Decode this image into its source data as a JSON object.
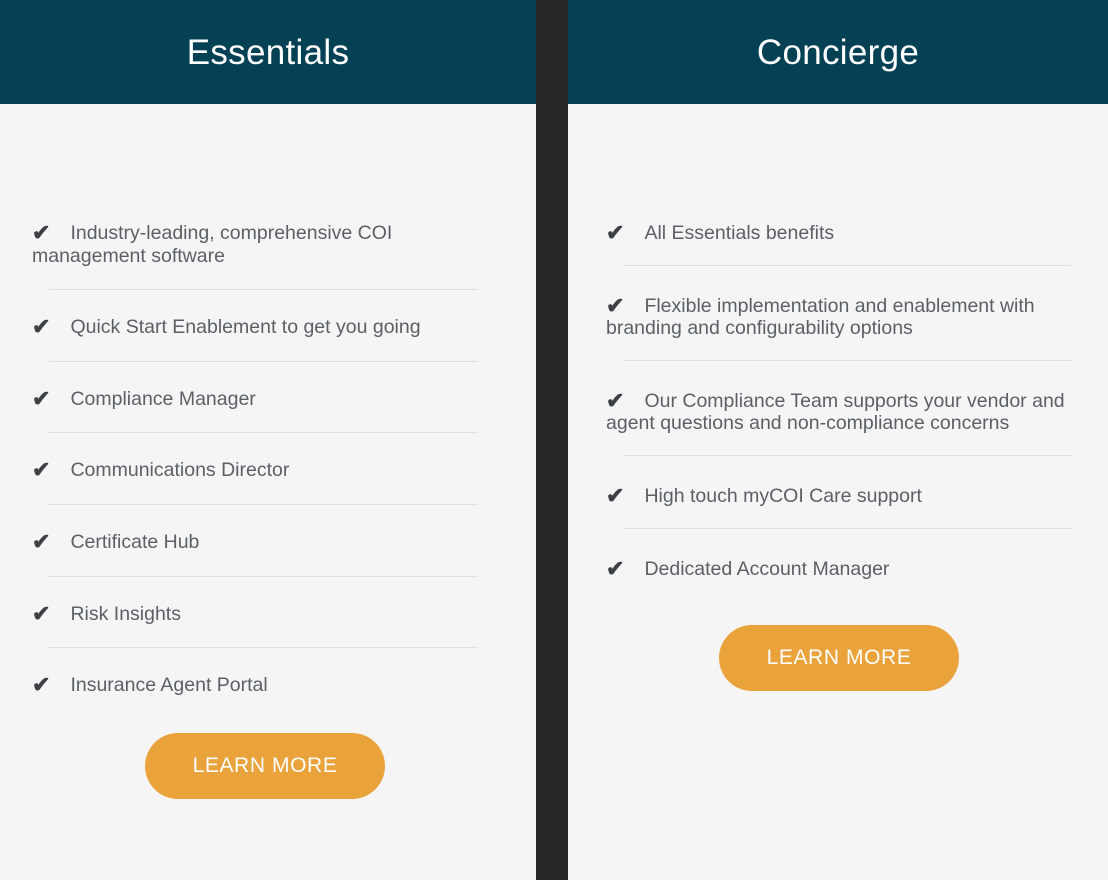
{
  "theme": {
    "header_bg": "#044155",
    "page_bg": "#f5f5f5",
    "divider_bg": "#272727",
    "cta_bg": "#e9a33a",
    "cta_text": "#ffffff",
    "feature_text": "#5b6066",
    "check_color": "#3d4146",
    "separator": "#dfdfdf"
  },
  "icons": {
    "check": "✔"
  },
  "plans": [
    {
      "name": "essentials",
      "title": "Essentials",
      "features": [
        "Industry-leading, comprehensive COI management software",
        "Quick Start Enablement to get you going",
        "Compliance Manager",
        "Communications Director",
        "Certificate Hub",
        "Risk Insights",
        "Insurance Agent Portal"
      ],
      "cta_label": "LEARN MORE"
    },
    {
      "name": "concierge",
      "title": "Concierge",
      "features": [
        "All Essentials benefits",
        "Flexible implementation and enablement with branding and configurability options",
        "Our Compliance Team supports your vendor and agent questions and non-compliance concerns",
        "High touch myCOI Care support",
        "Dedicated Account Manager"
      ],
      "cta_label": "LEARN MORE"
    }
  ]
}
